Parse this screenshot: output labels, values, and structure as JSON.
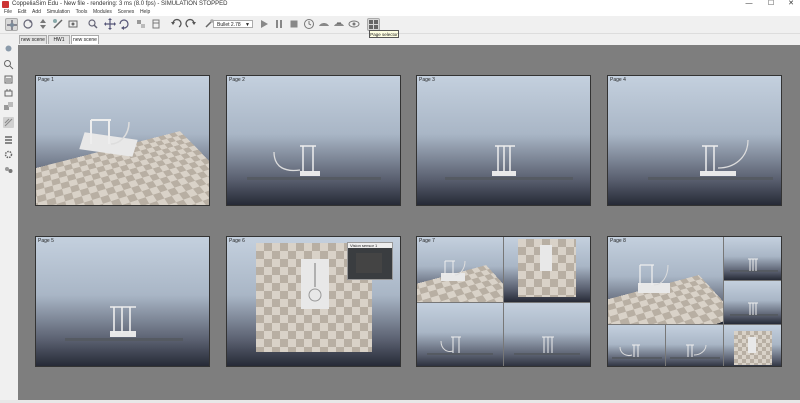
{
  "window": {
    "title": "CoppeliaSim Edu - New file - rendering: 3 ms (8.0 fps) - SIMULATION STOPPED",
    "minimize": "—",
    "maximize": "☐",
    "close": "✕"
  },
  "menu": [
    "File",
    "Edit",
    "Add",
    "Simulation",
    "Tools",
    "Modules",
    "Scenes",
    "Help"
  ],
  "toolbar": {
    "engine_select": "Bullet 2.78",
    "tooltip": "Page selector"
  },
  "tabs": [
    "new scene",
    "HW1",
    "new scene"
  ],
  "views": {
    "p1": "Page 1",
    "p2": "Page 2",
    "p3": "Page 3",
    "p4": "Page 4",
    "p5": "Page 5",
    "p6": "Page 6",
    "p7": "Page 7",
    "p8": "Page 8",
    "floating_view": "Vision sensor 1"
  },
  "colors": {
    "viewport_bg": "#7e7e7e",
    "sky_top": "#c4d0de",
    "sky_bottom": "#262a36",
    "tooltip_bg": "#ffffe1"
  }
}
